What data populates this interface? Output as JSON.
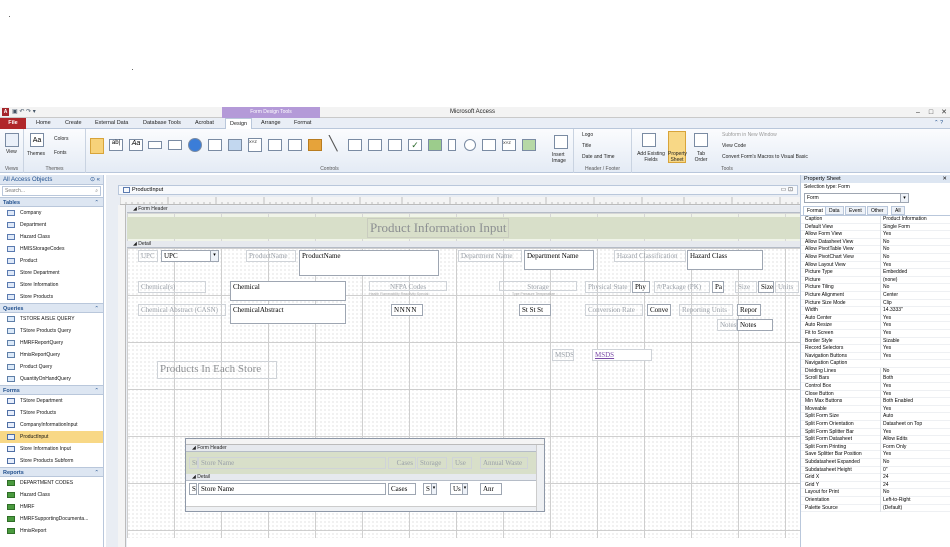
{
  "window": {
    "title": "Microsoft Access",
    "context_tab": "Form Design Tools",
    "controls": [
      "–",
      "□",
      "✕"
    ]
  },
  "ribbon": {
    "tabs": [
      {
        "label": "File"
      },
      {
        "label": "Home"
      },
      {
        "label": "Create"
      },
      {
        "label": "External Data"
      },
      {
        "label": "Database Tools"
      },
      {
        "label": "Acrobat"
      },
      {
        "label": "Design"
      },
      {
        "label": "Arrange"
      },
      {
        "label": "Format"
      }
    ],
    "active_tab": "Design",
    "groups": {
      "views": {
        "label": "Views",
        "view": "View"
      },
      "themes": {
        "label": "Themes",
        "themes": "Themes",
        "colors": "Colors",
        "fonts": "Fonts"
      },
      "controls": {
        "label": "Controls",
        "insert_image": "Insert Image"
      },
      "header_footer": {
        "label": "Header / Footer",
        "logo": "Logo",
        "title": "Title",
        "date_time": "Date and Time"
      },
      "tools": {
        "label": "Tools",
        "add_existing_fields": "Add Existing Fields",
        "property_sheet": "Property Sheet",
        "tab_order": "Tab Order",
        "subform": "Subform in New Window",
        "view_code": "View Code",
        "convert": "Convert Form's Macros to Visual Basic"
      }
    }
  },
  "nav": {
    "title": "All Access Objects",
    "search_placeholder": "Search...",
    "sections": [
      {
        "label": "Tables",
        "type": "t",
        "items": [
          "Company",
          "Department",
          "Hazard Class",
          "HMISStorageCodes",
          "Product",
          "Store Department",
          "Store Information",
          "Store Products"
        ]
      },
      {
        "label": "Queries",
        "type": "q",
        "items": [
          "TSTORE AISLE QUERY",
          "TStore Products Query",
          "HMRFReportQuery",
          "HmisReportQuery",
          "Product Query",
          "QuantityOnHandQuery"
        ]
      },
      {
        "label": "Forms",
        "type": "f",
        "items": [
          "TStore Department",
          "TStore Products",
          "CompanyInformationInput",
          "ProductInput",
          "Store Information Input",
          "Store Products Subform"
        ]
      },
      {
        "label": "Reports",
        "type": "r",
        "items": [
          "DEPARTMENT CODES",
          "Hazard Class",
          "HMRF",
          "HMRFSupportingDocumenta...",
          "HmisReport"
        ]
      }
    ],
    "selected": "ProductInput"
  },
  "document": {
    "tab_title": "ProductInput",
    "form_header_band": "Form Header",
    "detail_band": "Detail",
    "title_label": "Product Information Input",
    "controls": {
      "upc_label": "UPC",
      "upc_value": "UPC",
      "productname_label": "ProductName",
      "productname_value": "ProductName",
      "department_label": "Department Name",
      "department_value": "Department Name",
      "hazard_label": "Hazard Classification",
      "hazard_value": "Hazard Class",
      "chemical_label": "Chemical(s)",
      "chemical_value": "Chemical",
      "nfpa_label": "NFPA Codes",
      "nfpa_sub": "Health Flammability Reactivity Special",
      "storage_label": "Storage",
      "storage_sub": "Type Pressure Temperature",
      "physical_label": "Physical State",
      "physical_value": "Phy",
      "package_label": "#/Package (PK)",
      "package_value": "Pa",
      "size_label": "Size",
      "size_value": "Size",
      "units_label": "Units",
      "abstract_label": "Chemical Abstract (CASN)",
      "abstract_value": "ChemicalAbstract",
      "nfpa_values": "N N N N",
      "storage_values": "St St St",
      "conversion_label": "Conversion Rate",
      "conversion_value": "Conve",
      "reporting_label": "Reporting Units",
      "reporting_value": "Repor",
      "notes_label": "Notes",
      "notes_value": "Notes",
      "msds_label": "MSDS",
      "msds_link": "MSDS",
      "products_each_store": "Products In Each Store"
    },
    "subform": {
      "header_band": "Form Header",
      "detail_band": "Detail",
      "headers": [
        "St",
        "Store Name",
        "Cases",
        "Storage",
        "Use",
        "Annual Waste"
      ],
      "row": [
        "S",
        "Store Name",
        "Cases",
        "S",
        "Us",
        "Anr"
      ]
    }
  },
  "property_sheet": {
    "title": "Property Sheet",
    "selection_type": "Selection type:  Form",
    "selected": "Form",
    "tabs": [
      "Format",
      "Data",
      "Event",
      "Other",
      "All"
    ],
    "active_tab": "Format",
    "rows": [
      [
        "Caption",
        "Product Information"
      ],
      [
        "Default View",
        "Single Form"
      ],
      [
        "Allow Form View",
        "Yes"
      ],
      [
        "Allow Datasheet View",
        "No"
      ],
      [
        "Allow PivotTable View",
        "No"
      ],
      [
        "Allow PivotChart View",
        "No"
      ],
      [
        "Allow Layout View",
        "Yes"
      ],
      [
        "Picture Type",
        "Embedded"
      ],
      [
        "Picture",
        "(none)"
      ],
      [
        "Picture Tiling",
        "No"
      ],
      [
        "Picture Alignment",
        "Center"
      ],
      [
        "Picture Size Mode",
        "Clip"
      ],
      [
        "Width",
        "14.3333\""
      ],
      [
        "Auto Center",
        "Yes"
      ],
      [
        "Auto Resize",
        "Yes"
      ],
      [
        "Fit to Screen",
        "Yes"
      ],
      [
        "Border Style",
        "Sizable"
      ],
      [
        "Record Selectors",
        "Yes"
      ],
      [
        "Navigation Buttons",
        "Yes"
      ],
      [
        "Navigation Caption",
        ""
      ],
      [
        "Dividing Lines",
        "No"
      ],
      [
        "Scroll Bars",
        "Both"
      ],
      [
        "Control Box",
        "Yes"
      ],
      [
        "Close Button",
        "Yes"
      ],
      [
        "Min Max Buttons",
        "Both Enabled"
      ],
      [
        "Moveable",
        "Yes"
      ],
      [
        "Split Form Size",
        "Auto"
      ],
      [
        "Split Form Orientation",
        "Datasheet on Top"
      ],
      [
        "Split Form Splitter Bar",
        "Yes"
      ],
      [
        "Split Form Datasheet",
        "Allow Edits"
      ],
      [
        "Split Form Printing",
        "Form Only"
      ],
      [
        "Save Splitter Bar Position",
        "Yes"
      ],
      [
        "Subdatasheet Expanded",
        "No"
      ],
      [
        "Subdatasheet Height",
        "0\""
      ],
      [
        "Grid X",
        "24"
      ],
      [
        "Grid Y",
        "24"
      ],
      [
        "Layout for Print",
        "No"
      ],
      [
        "Orientation",
        "Left-to-Right"
      ],
      [
        "Palette Source",
        "(Default)"
      ]
    ]
  }
}
